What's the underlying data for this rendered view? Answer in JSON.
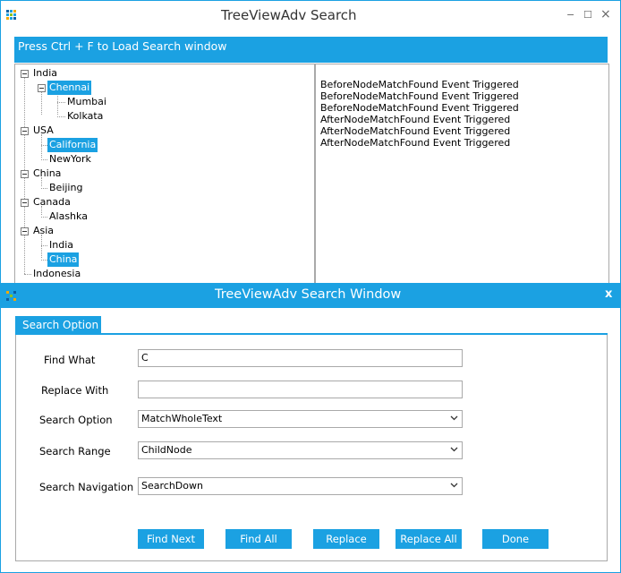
{
  "main_window": {
    "title": "TreeViewAdv Search",
    "minimize": "−",
    "maximize": "☐",
    "close": "×"
  },
  "banner": {
    "text": "Press Ctrl + F to Load Search window"
  },
  "tree": {
    "nodes": [
      {
        "label": "India",
        "level": 0,
        "expanded": true,
        "selected": false
      },
      {
        "label": "Chennai",
        "level": 1,
        "expanded": true,
        "selected": true
      },
      {
        "label": "Mumbai",
        "level": 2,
        "expanded": false,
        "selected": false
      },
      {
        "label": "Kolkata",
        "level": 2,
        "expanded": false,
        "selected": false
      },
      {
        "label": "USA",
        "level": 0,
        "expanded": true,
        "selected": false
      },
      {
        "label": "California",
        "level": 1,
        "expanded": false,
        "selected": true
      },
      {
        "label": "NewYork",
        "level": 1,
        "expanded": false,
        "selected": false
      },
      {
        "label": "China",
        "level": 0,
        "expanded": true,
        "selected": false
      },
      {
        "label": "Beijing",
        "level": 1,
        "expanded": false,
        "selected": false
      },
      {
        "label": "Canada",
        "level": 0,
        "expanded": true,
        "selected": false
      },
      {
        "label": "Alashka",
        "level": 1,
        "expanded": false,
        "selected": false
      },
      {
        "label": "Asia",
        "level": 0,
        "expanded": true,
        "selected": false
      },
      {
        "label": "India",
        "level": 1,
        "expanded": false,
        "selected": false
      },
      {
        "label": "China",
        "level": 1,
        "expanded": false,
        "selected": true
      },
      {
        "label": "Indonesia",
        "level": 0,
        "expanded": false,
        "selected": false
      }
    ]
  },
  "event_log": [
    "BeforeNodeMatchFound Event Triggered",
    "BeforeNodeMatchFound Event Triggered",
    "BeforeNodeMatchFound Event Triggered",
    "AfterNodeMatchFound Event Triggered",
    "AfterNodeMatchFound Event Triggered",
    "AfterNodeMatchFound Event Triggered"
  ],
  "search_window": {
    "title": "TreeViewAdv Search Window",
    "close": "x",
    "tab_label": "Search Option",
    "find_what": {
      "label": "Find What",
      "value": "C"
    },
    "replace_with": {
      "label": "Replace With",
      "value": ""
    },
    "search_option": {
      "label": "Search Option",
      "value": "MatchWholeText"
    },
    "search_range": {
      "label": "Search Range",
      "value": "ChildNode"
    },
    "search_navigation": {
      "label": "Search Navigation",
      "value": "SearchDown"
    },
    "buttons": {
      "find_next": "Find Next",
      "find_all": "Find All",
      "replace": "Replace",
      "replace_all": "Replace All",
      "done": "Done"
    }
  },
  "colors": {
    "accent": "#1ba1e2",
    "border": "#a9a9a9"
  }
}
